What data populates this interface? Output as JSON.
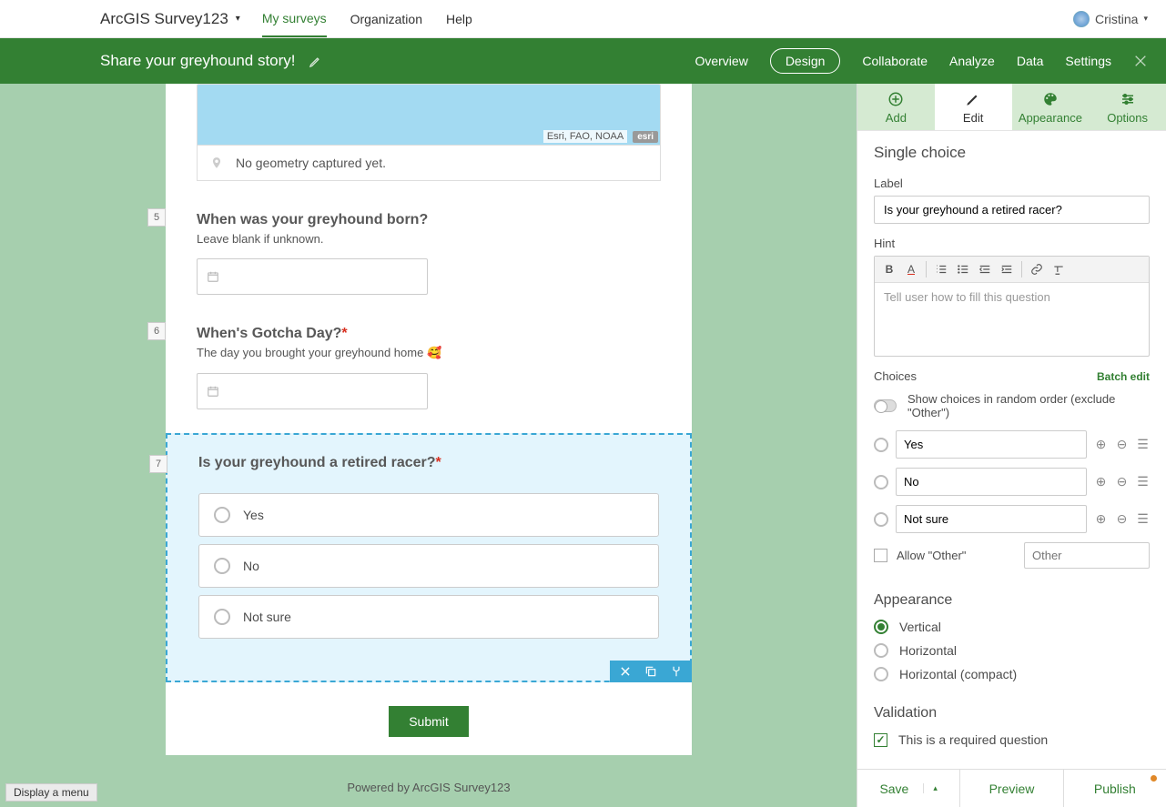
{
  "topnav": {
    "brand": "ArcGIS Survey123",
    "items": [
      "My surveys",
      "Organization",
      "Help"
    ],
    "active_index": 0,
    "user": "Cristina"
  },
  "greenbar": {
    "title": "Share your greyhound story!",
    "tabs": [
      "Overview",
      "Design",
      "Collaborate",
      "Analyze",
      "Data",
      "Settings"
    ],
    "active_index": 1
  },
  "form": {
    "map_attribution": "Esri, FAO, NOAA",
    "esri_logo": "esri",
    "geom_message": "No geometry captured yet.",
    "q5": {
      "num": "5",
      "label": "When was your greyhound born?",
      "hint": "Leave blank if unknown."
    },
    "q6": {
      "num": "6",
      "label": "When's Gotcha Day?",
      "hint": "The day you brought your greyhound home 🥰"
    },
    "q7": {
      "num": "7",
      "label": "Is your greyhound a retired racer?",
      "choices": [
        "Yes",
        "No",
        "Not sure"
      ]
    },
    "submit": "Submit",
    "powered": "Powered by ArcGIS Survey123"
  },
  "status_bar": "Display a menu",
  "panel": {
    "tabs": [
      "Add",
      "Edit",
      "Appearance",
      "Options"
    ],
    "section_title": "Single choice",
    "label_label": "Label",
    "label_value": "Is your greyhound a retired racer?",
    "hint_label": "Hint",
    "hint_placeholder": "Tell user how to fill this question",
    "choices_label": "Choices",
    "batch_edit": "Batch edit",
    "random_label": "Show choices in random order (exclude \"Other\")",
    "choice_values": [
      "Yes",
      "No",
      "Not sure"
    ],
    "allow_other": "Allow \"Other\"",
    "other_placeholder": "Other",
    "appearance_heading": "Appearance",
    "appearance_opts": [
      "Vertical",
      "Horizontal",
      "Horizontal (compact)"
    ],
    "validation_heading": "Validation",
    "required_label": "This is a required question",
    "actions": {
      "save": "Save",
      "preview": "Preview",
      "publish": "Publish"
    }
  }
}
